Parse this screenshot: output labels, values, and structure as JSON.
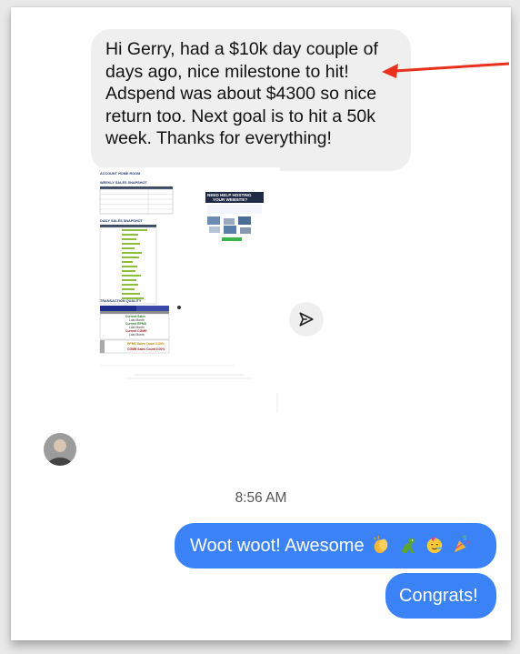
{
  "incoming_message": {
    "text": "Hi Gerry, had a $10k day couple of\ndays ago, nice milestone to hit!\nAdspend was about $4300 so nice\nreturn too. Next goal is to hit a 50k\nweek. Thanks for everything!"
  },
  "annotation": {
    "arrow_color": "#e8301c"
  },
  "report": {
    "header": "ACCOUNT HOME ROOM",
    "weekly_title": "WEEKLY SALES SNAPSHOT",
    "daily_title": "DAILY SALES SNAPSHOT",
    "ad_lines": [
      "NEED HELP HOSTING",
      "YOUR WEBSITE?"
    ],
    "transaction_title": "TRANSACTION QUALITY",
    "rows": [
      "Current Sales",
      "Last Month",
      "Current RPMS",
      "Last Month",
      "Current CGMR",
      "Last Month"
    ],
    "rates": [
      "RPMS Sales Count 0.00%",
      "CGMR Sales Count 0.00%"
    ]
  },
  "share_button": {
    "icon": "send-arrow-icon"
  },
  "timestamp": "8:56 AM",
  "outgoing_messages": [
    {
      "text": "Woot woot! Awesome",
      "emojis": [
        "clapping-hands-emoji",
        "t-rex-emoji",
        "partying-face-emoji",
        "party-popper-emoji"
      ]
    },
    {
      "text": "Congrats!"
    }
  ],
  "colors": {
    "outgoing_bubble": "#3b82f6",
    "incoming_bubble": "#efefef"
  }
}
